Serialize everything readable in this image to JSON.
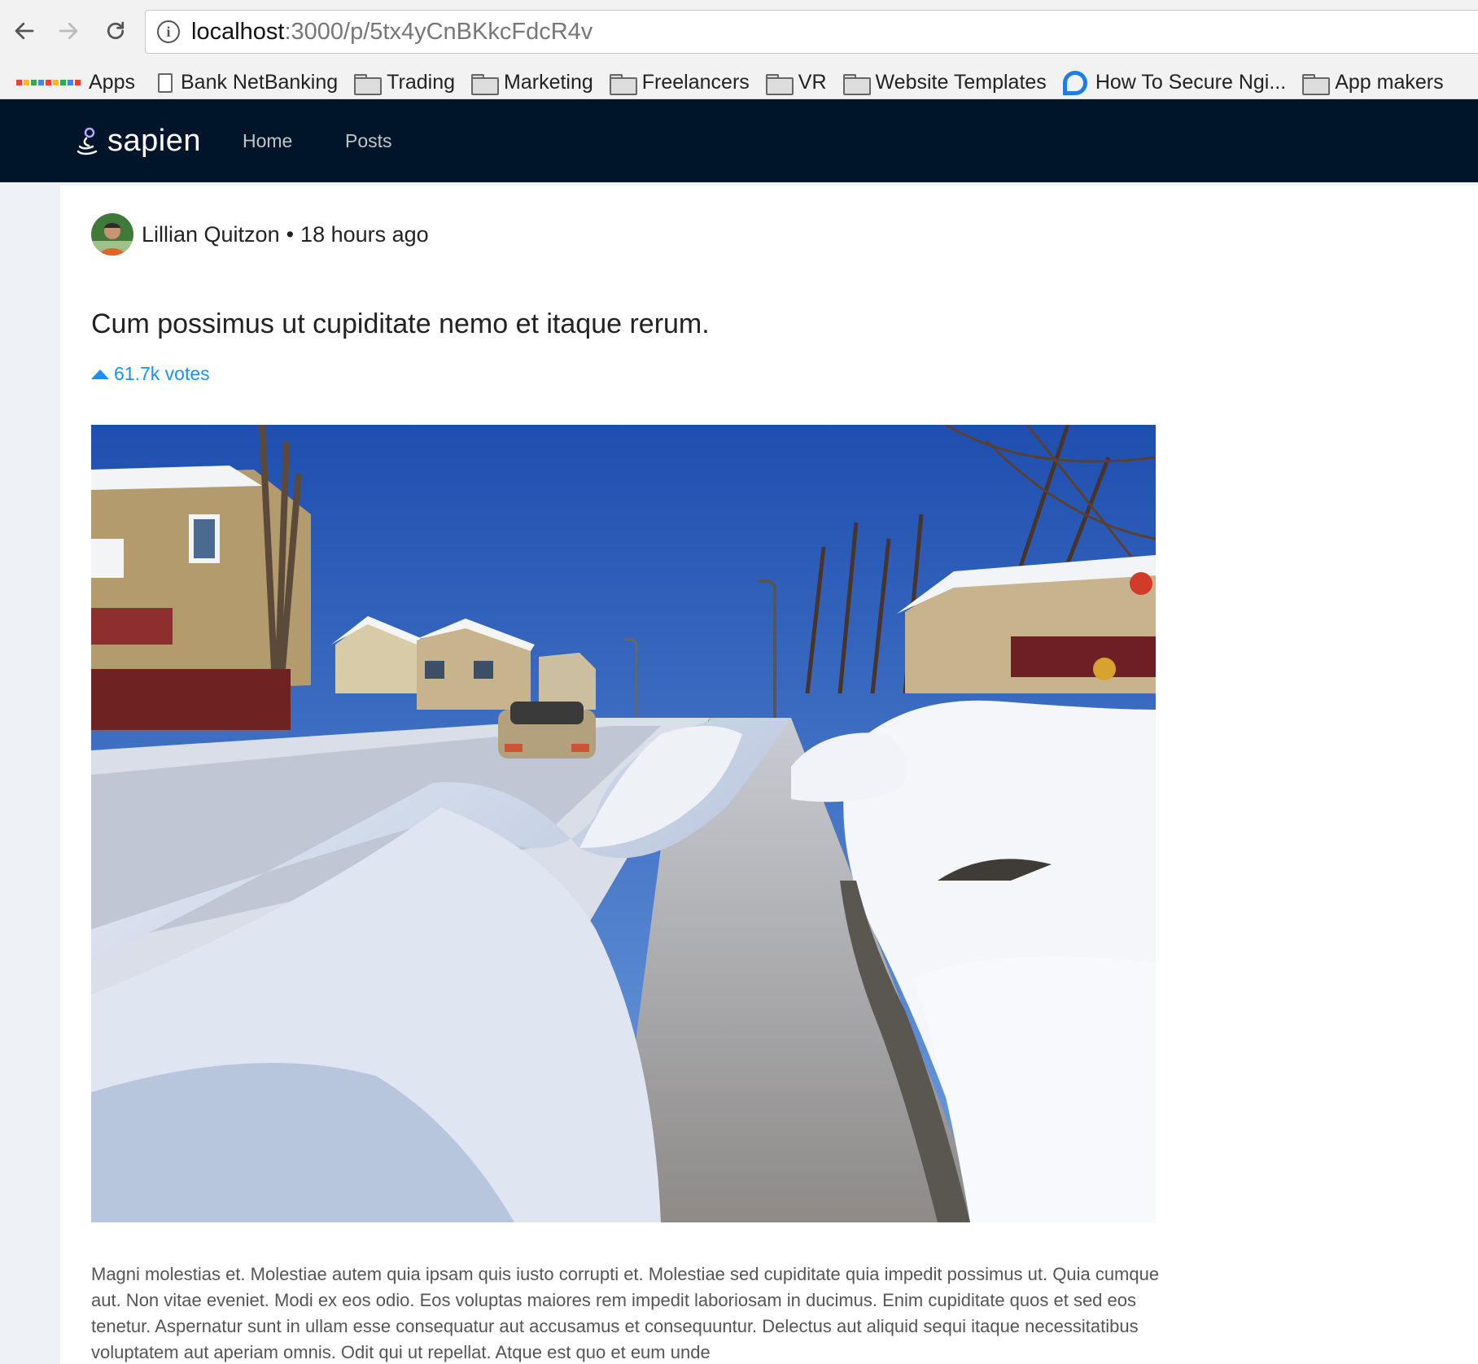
{
  "browser": {
    "url_host": "localhost",
    "url_path": ":3000/p/5tx4yCnBKkcFdcR4v",
    "bookmarks": [
      {
        "label": "Apps",
        "icon": "apps-grid-icon"
      },
      {
        "label": "Bank NetBanking",
        "icon": "page-icon"
      },
      {
        "label": "Trading",
        "icon": "folder-icon"
      },
      {
        "label": "Marketing",
        "icon": "folder-icon"
      },
      {
        "label": "Freelancers",
        "icon": "folder-icon"
      },
      {
        "label": "VR",
        "icon": "folder-icon"
      },
      {
        "label": "Website Templates",
        "icon": "folder-icon"
      },
      {
        "label": "How To Secure Ngi...",
        "icon": "digitalocean-icon"
      },
      {
        "label": "App makers",
        "icon": "folder-icon"
      }
    ]
  },
  "header": {
    "logo_text": "sapien",
    "nav": [
      "Home",
      "Posts"
    ],
    "background": "#001529"
  },
  "post": {
    "author": "Lillian Quitzon",
    "time_ago": "18 hours ago",
    "title": "Cum possimus ut cupiditate nemo et itaque rerum.",
    "votes": "61.7k votes",
    "body": "Magni molestias et. Molestiae autem quia ipsam quis iusto corrupti et. Molestiae sed cupiditate quia impedit possimus ut. Quia cumque aut. Non vitae eveniet. Modi ex eos odio. Eos voluptas maiores rem impedit laboriosam in ducimus. Enim cupiditate quos et sed eos tenetur. Aspernatur sunt in ullam esse consequatur aut accusamus et consequuntur. Delectus aut aliquid sequi itaque necessitatibus voluptatem aut aperiam omnis. Odit qui ut repellat. Atque est quo et eum unde"
  },
  "colors": {
    "accent": "#1890ff"
  }
}
